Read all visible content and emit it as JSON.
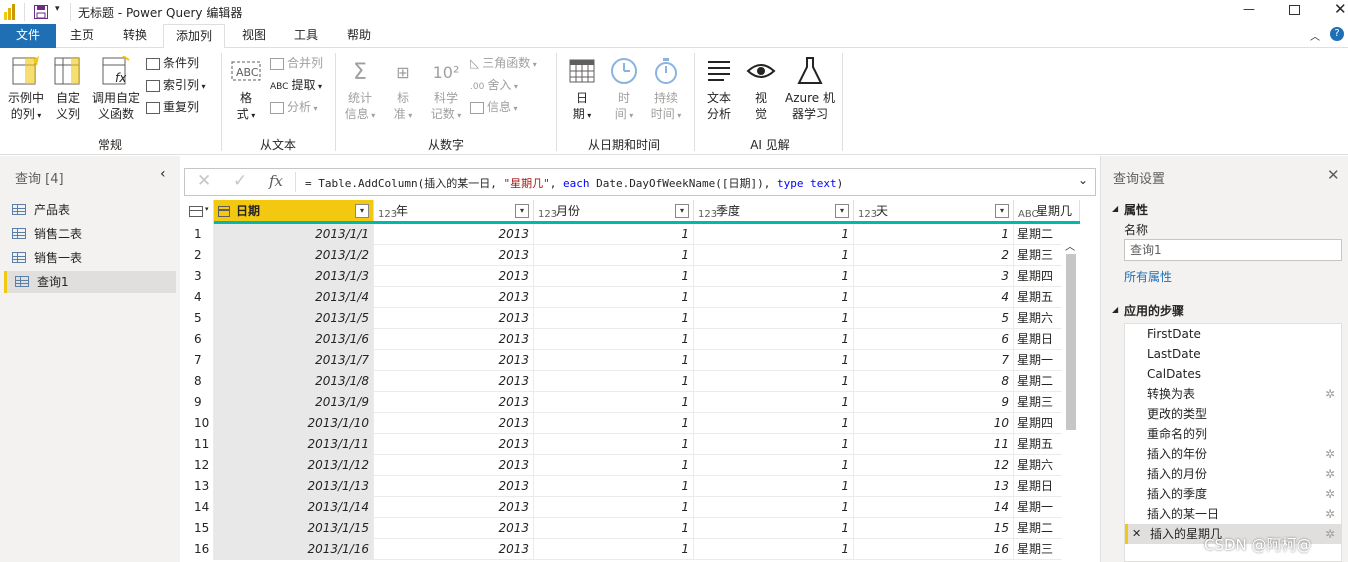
{
  "window": {
    "title": "无标题 - Power Query 编辑器"
  },
  "tabs": [
    {
      "label": "文件"
    },
    {
      "label": "主页"
    },
    {
      "label": "转换"
    },
    {
      "label": "添加列"
    },
    {
      "label": "视图"
    },
    {
      "label": "工具"
    },
    {
      "label": "帮助"
    }
  ],
  "ribbon": {
    "general": {
      "label": "常规",
      "example_col": [
        "示例中",
        "的列"
      ],
      "custom_col": [
        "自定",
        "义列"
      ],
      "invoke_fn": [
        "调用自定",
        "义函数"
      ],
      "conditional": "条件列",
      "index": "索引列",
      "duplicate": "重复列"
    },
    "text": {
      "label": "从文本",
      "format": [
        "格",
        "式"
      ],
      "merge": "合并列",
      "extract": "提取",
      "parse": "分析"
    },
    "number": {
      "label": "从数字",
      "stats": [
        "统计",
        "信息"
      ],
      "standard": [
        "标",
        "准"
      ],
      "scientific": [
        "科学",
        "记数"
      ],
      "trig": "三角函数",
      "round": "舍入",
      "info": "信息"
    },
    "datetime": {
      "label": "从日期和时间",
      "date": [
        "日",
        "期"
      ],
      "time": [
        "时",
        "间"
      ],
      "duration": [
        "持续",
        "时间"
      ]
    },
    "ai": {
      "label": "AI 见解",
      "text_analytics": [
        "文本",
        "分析"
      ],
      "vision": [
        "视",
        "觉"
      ],
      "azure_ml": [
        "Azure 机",
        "器学习"
      ]
    }
  },
  "queries_pane": {
    "header": "查询 [4]",
    "items": [
      "产品表",
      "销售二表",
      "销售一表",
      "查询1"
    ],
    "selected_index": 3
  },
  "formula_bar": {
    "fx": "fx",
    "parts": [
      {
        "t": "= Table.AddColumn(插入的某一日, ",
        "c": "#252423"
      },
      {
        "t": "\"星期几\"",
        "c": "#a31515"
      },
      {
        "t": ", ",
        "c": "#252423"
      },
      {
        "t": "each",
        "c": "#0000ff"
      },
      {
        "t": " Date.DayOfWeekName([日期]), ",
        "c": "#252423"
      },
      {
        "t": "type",
        "c": "#0000ff"
      },
      {
        "t": " ",
        "c": "#252423"
      },
      {
        "t": "text",
        "c": "#0000ff"
      },
      {
        "t": ")",
        "c": "#252423"
      }
    ]
  },
  "table": {
    "columns": [
      {
        "name": "日期",
        "type_icon": "date-type"
      },
      {
        "name": "年",
        "type_icon": "123"
      },
      {
        "name": "月份",
        "type_icon": "123"
      },
      {
        "name": "季度",
        "type_icon": "123"
      },
      {
        "name": "天",
        "type_icon": "123"
      },
      {
        "name": "星期几",
        "type_icon": "ABC"
      }
    ],
    "rows": [
      [
        "1",
        "2013/1/1",
        "2013",
        "1",
        "1",
        "1",
        "星期二"
      ],
      [
        "2",
        "2013/1/2",
        "2013",
        "1",
        "1",
        "2",
        "星期三"
      ],
      [
        "3",
        "2013/1/3",
        "2013",
        "1",
        "1",
        "3",
        "星期四"
      ],
      [
        "4",
        "2013/1/4",
        "2013",
        "1",
        "1",
        "4",
        "星期五"
      ],
      [
        "5",
        "2013/1/5",
        "2013",
        "1",
        "1",
        "5",
        "星期六"
      ],
      [
        "6",
        "2013/1/6",
        "2013",
        "1",
        "1",
        "6",
        "星期日"
      ],
      [
        "7",
        "2013/1/7",
        "2013",
        "1",
        "1",
        "7",
        "星期一"
      ],
      [
        "8",
        "2013/1/8",
        "2013",
        "1",
        "1",
        "8",
        "星期二"
      ],
      [
        "9",
        "2013/1/9",
        "2013",
        "1",
        "1",
        "9",
        "星期三"
      ],
      [
        "10",
        "2013/1/10",
        "2013",
        "1",
        "1",
        "10",
        "星期四"
      ],
      [
        "11",
        "2013/1/11",
        "2013",
        "1",
        "1",
        "11",
        "星期五"
      ],
      [
        "12",
        "2013/1/12",
        "2013",
        "1",
        "1",
        "12",
        "星期六"
      ],
      [
        "13",
        "2013/1/13",
        "2013",
        "1",
        "1",
        "13",
        "星期日"
      ],
      [
        "14",
        "2013/1/14",
        "2013",
        "1",
        "1",
        "14",
        "星期一"
      ],
      [
        "15",
        "2013/1/15",
        "2013",
        "1",
        "1",
        "15",
        "星期二"
      ],
      [
        "16",
        "2013/1/16",
        "2013",
        "1",
        "1",
        "16",
        "星期三"
      ]
    ]
  },
  "settings_pane": {
    "header": "查询设置",
    "properties_label": "属性",
    "name_label": "名称",
    "name_value": "查询1",
    "all_properties": "所有属性",
    "steps_label": "应用的步骤",
    "steps": [
      {
        "name": "FirstDate",
        "gear": false
      },
      {
        "name": "LastDate",
        "gear": false
      },
      {
        "name": "CalDates",
        "gear": false
      },
      {
        "name": "转换为表",
        "gear": true
      },
      {
        "name": "更改的类型",
        "gear": false
      },
      {
        "name": "重命名的列",
        "gear": false
      },
      {
        "name": "插入的年份",
        "gear": true
      },
      {
        "name": "插入的月份",
        "gear": true
      },
      {
        "name": "插入的季度",
        "gear": true
      },
      {
        "name": "插入的某一日",
        "gear": true
      },
      {
        "name": "插入的星期几",
        "gear": true
      }
    ],
    "selected_step": 10
  },
  "watermark": "CSDN @阿柯@",
  "colors": {
    "accent": "#f2c811",
    "file_tab": "#1f6fb5",
    "teal": "#01b8aa"
  }
}
